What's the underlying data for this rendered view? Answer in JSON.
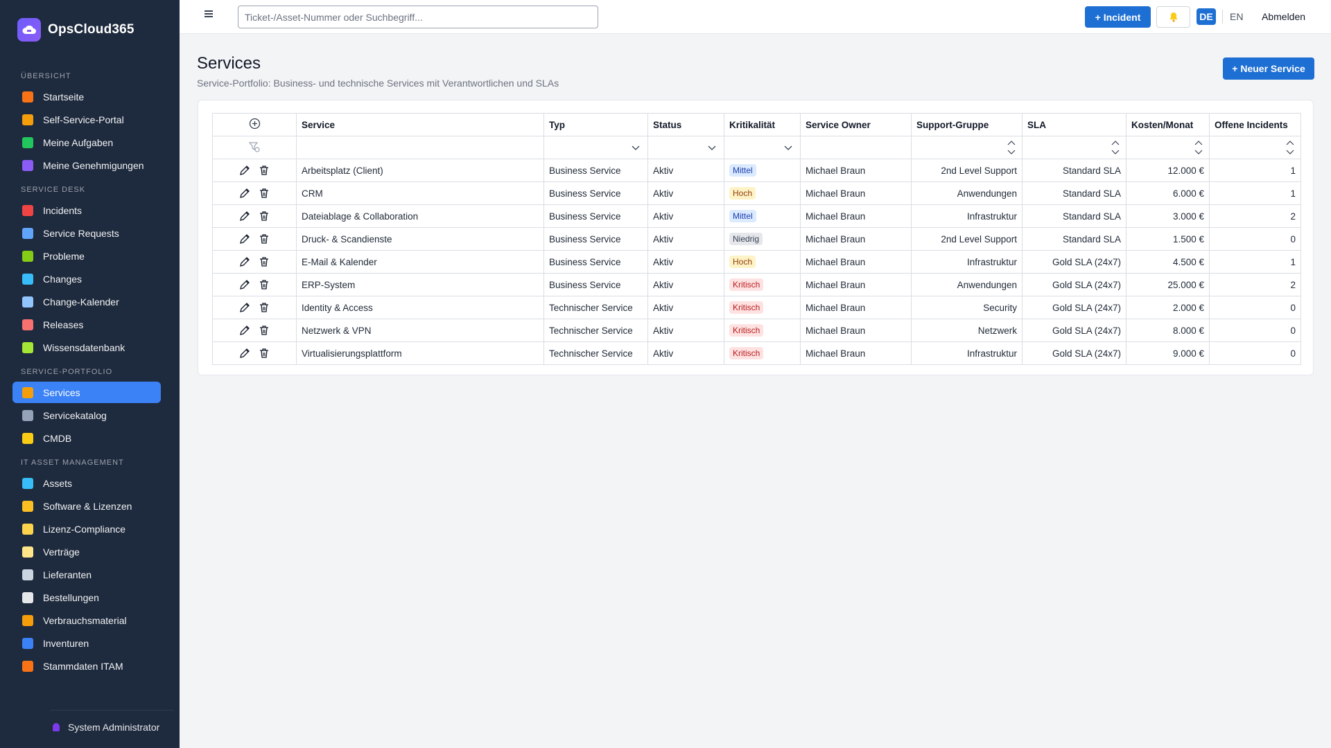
{
  "brand": {
    "name": "OpsCloud365"
  },
  "sidebar": {
    "sections": [
      {
        "title": "ÜBERSICHT",
        "items": [
          {
            "label": "Startseite",
            "icon": "home-icon",
            "color": "#f97316"
          },
          {
            "label": "Self-Service-Portal",
            "icon": "person-icon",
            "color": "#f59e0b"
          },
          {
            "label": "Meine Aufgaben",
            "icon": "check-box-icon",
            "color": "#22c55e"
          },
          {
            "label": "Meine Genehmigungen",
            "icon": "check-mark-icon",
            "color": "#8b5cf6"
          }
        ]
      },
      {
        "title": "SERVICE DESK",
        "items": [
          {
            "label": "Incidents",
            "icon": "siren-icon",
            "color": "#ef4444"
          },
          {
            "label": "Service Requests",
            "icon": "inbox-icon",
            "color": "#60a5fa"
          },
          {
            "label": "Probleme",
            "icon": "puzzle-icon",
            "color": "#84cc16"
          },
          {
            "label": "Changes",
            "icon": "cycle-icon",
            "color": "#38bdf8"
          },
          {
            "label": "Change-Kalender",
            "icon": "calendar-icon",
            "color": "#93c5fd"
          },
          {
            "label": "Releases",
            "icon": "rocket-icon",
            "color": "#f87171"
          },
          {
            "label": "Wissensdatenbank",
            "icon": "books-icon",
            "color": "#a3e635"
          }
        ]
      },
      {
        "title": "SERVICE-PORTFOLIO",
        "items": [
          {
            "label": "Services",
            "icon": "bell-service-icon",
            "color": "#f59e0b",
            "active": true
          },
          {
            "label": "Servicekatalog",
            "icon": "catalog-icon",
            "color": "#94a3b8"
          },
          {
            "label": "CMDB",
            "icon": "folder-icon",
            "color": "#facc15"
          }
        ]
      },
      {
        "title": "IT ASSET MANAGEMENT",
        "items": [
          {
            "label": "Assets",
            "icon": "laptop-icon",
            "color": "#38bdf8"
          },
          {
            "label": "Software & Lizenzen",
            "icon": "disc-icon",
            "color": "#fbbf24"
          },
          {
            "label": "Lizenz-Compliance",
            "icon": "scale-icon",
            "color": "#fcd34d"
          },
          {
            "label": "Verträge",
            "icon": "scroll-icon",
            "color": "#fde68a"
          },
          {
            "label": "Lieferanten",
            "icon": "building-icon",
            "color": "#cbd5e1"
          },
          {
            "label": "Bestellungen",
            "icon": "receipt-icon",
            "color": "#e5e7eb"
          },
          {
            "label": "Verbrauchsmaterial",
            "icon": "box-icon",
            "color": "#f59e0b"
          },
          {
            "label": "Inventuren",
            "icon": "magnifier-icon",
            "color": "#3b82f6"
          },
          {
            "label": "Stammdaten ITAM",
            "icon": "bricks-icon",
            "color": "#f97316"
          }
        ]
      }
    ],
    "user": "System Administrator"
  },
  "topbar": {
    "search_placeholder": "Ticket-/Asset-Nummer oder Suchbegriff...",
    "incident_button": "+ Incident",
    "lang_de": "DE",
    "lang_en": "EN",
    "logout": "Abmelden"
  },
  "page": {
    "title": "Services",
    "subtitle": "Service-Portfolio: Business- und technische Services mit Verantwortlichen und SLAs",
    "new_button": "+ Neuer Service"
  },
  "table": {
    "columns": [
      "Service",
      "Typ",
      "Status",
      "Kritikalität",
      "Service Owner",
      "Support-Gruppe",
      "SLA",
      "Kosten/Monat",
      "Offene Incidents"
    ],
    "rows": [
      {
        "service": "Arbeitsplatz (Client)",
        "typ": "Business Service",
        "status": "Aktiv",
        "krit": "Mittel",
        "owner": "Michael Braun",
        "group": "2nd Level Support",
        "sla": "Standard SLA",
        "kosten": "12.000 €",
        "incidents": "1"
      },
      {
        "service": "CRM",
        "typ": "Business Service",
        "status": "Aktiv",
        "krit": "Hoch",
        "owner": "Michael Braun",
        "group": "Anwendungen",
        "sla": "Standard SLA",
        "kosten": "6.000 €",
        "incidents": "1"
      },
      {
        "service": "Dateiablage & Collaboration",
        "typ": "Business Service",
        "status": "Aktiv",
        "krit": "Mittel",
        "owner": "Michael Braun",
        "group": "Infrastruktur",
        "sla": "Standard SLA",
        "kosten": "3.000 €",
        "incidents": "2"
      },
      {
        "service": "Druck- & Scandienste",
        "typ": "Business Service",
        "status": "Aktiv",
        "krit": "Niedrig",
        "owner": "Michael Braun",
        "group": "2nd Level Support",
        "sla": "Standard SLA",
        "kosten": "1.500 €",
        "incidents": "0"
      },
      {
        "service": "E-Mail & Kalender",
        "typ": "Business Service",
        "status": "Aktiv",
        "krit": "Hoch",
        "owner": "Michael Braun",
        "group": "Infrastruktur",
        "sla": "Gold SLA (24x7)",
        "kosten": "4.500 €",
        "incidents": "1"
      },
      {
        "service": "ERP-System",
        "typ": "Business Service",
        "status": "Aktiv",
        "krit": "Kritisch",
        "owner": "Michael Braun",
        "group": "Anwendungen",
        "sla": "Gold SLA (24x7)",
        "kosten": "25.000 €",
        "incidents": "2"
      },
      {
        "service": "Identity & Access",
        "typ": "Technischer Service",
        "status": "Aktiv",
        "krit": "Kritisch",
        "owner": "Michael Braun",
        "group": "Security",
        "sla": "Gold SLA (24x7)",
        "kosten": "2.000 €",
        "incidents": "0"
      },
      {
        "service": "Netzwerk & VPN",
        "typ": "Technischer Service",
        "status": "Aktiv",
        "krit": "Kritisch",
        "owner": "Michael Braun",
        "group": "Netzwerk",
        "sla": "Gold SLA (24x7)",
        "kosten": "8.000 €",
        "incidents": "0"
      },
      {
        "service": "Virtualisierungsplattform",
        "typ": "Technischer Service",
        "status": "Aktiv",
        "krit": "Kritisch",
        "owner": "Michael Braun",
        "group": "Infrastruktur",
        "sla": "Gold SLA (24x7)",
        "kosten": "9.000 €",
        "incidents": "0"
      }
    ]
  },
  "badge_colors": {
    "Mittel": {
      "bg": "#dbeafe",
      "fg": "#1e40af"
    },
    "Hoch": {
      "bg": "#fef3c7",
      "fg": "#92400e"
    },
    "Niedrig": {
      "bg": "#e5e7eb",
      "fg": "#374151"
    },
    "Kritisch": {
      "bg": "#fee2e2",
      "fg": "#b91c1c"
    }
  }
}
